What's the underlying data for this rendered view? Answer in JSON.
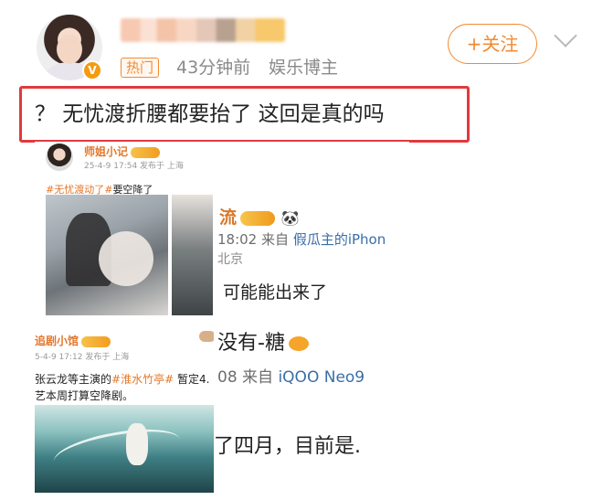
{
  "post": {
    "follow_label": "+关注",
    "hot_tag": "热门",
    "time": "43分钟前",
    "source": "娱乐博主",
    "verified_badge": "V",
    "text": "？ 无忧渡折腰都要抬了 这回是真的吗",
    "highlight_color": "#e03a3e",
    "accent_color": "#f28a32"
  },
  "image": {
    "card1": {
      "name": "师姐小记",
      "meta": "25-4-9 17:54  发布于 上海",
      "hashtag": "#无忧渡动了#",
      "text_after": "要空降了"
    },
    "card2": {
      "name": "流",
      "line1_time": "18:02",
      "line1_from": "来自",
      "line1_source": "假瓜主的iPhon",
      "line2": "北京",
      "line3": "可能能出来了",
      "line4": "没有-糖",
      "line5_prefix": "08",
      "line5_from": "来自",
      "line5_source": "iQOO Neo9",
      "line6": "了四月，目前是."
    },
    "card3": {
      "name": "追剧小馆",
      "meta": "5-4-9 17:12  发布于 上海",
      "text1_prefix": "张云龙等主演的",
      "hashtag": "#淮水竹亭#",
      "text1_suffix": " 暂定4.",
      "text2": "艺本周打算空降剧。"
    }
  }
}
